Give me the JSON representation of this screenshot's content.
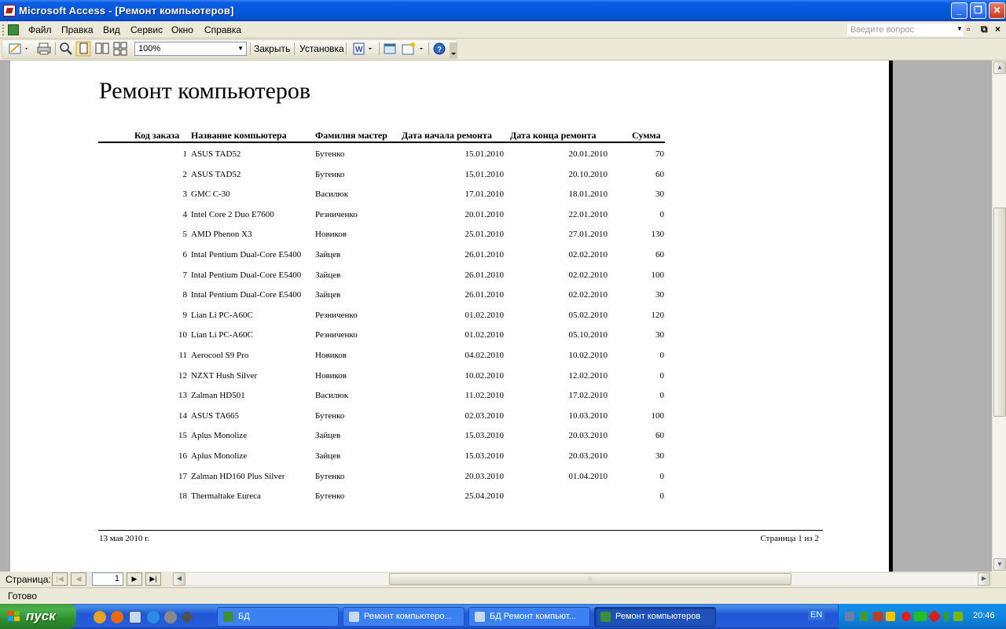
{
  "window": {
    "title": "Microsoft Access - [Ремонт компьютеров]"
  },
  "menu": {
    "items": [
      "Файл",
      "Правка",
      "Вид",
      "Сервис",
      "Окно",
      "Справка"
    ],
    "ask_placeholder": "Введите вопрос"
  },
  "toolbar": {
    "zoom": "100%",
    "close_label": "Закрыть",
    "setup_label": "Установка"
  },
  "report": {
    "title": "Ремонт компьютеров",
    "columns": [
      "Код заказа",
      "Название компьютера",
      "Фамилия мастер",
      "Дата начала ремонта",
      "Дата конца ремонта",
      "Сумма"
    ],
    "rows": [
      [
        "1",
        "ASUS  TAD52",
        "Бутенко",
        "15.01.2010",
        "20.01.2010",
        "70"
      ],
      [
        "2",
        "ASUS  TAD52",
        "Бутенко",
        "15.01.2010",
        "20.10.2010",
        "60"
      ],
      [
        "3",
        "GMC C-30",
        "Василюк",
        "17.01.2010",
        "18.01.2010",
        "30"
      ],
      [
        "4",
        "Intel Core 2 Duo E7600",
        "Резниченко",
        "20.01.2010",
        "22.01.2010",
        "0"
      ],
      [
        "5",
        "AMD Phenon X3",
        "Новиков",
        "25.01.2010",
        "27.01.2010",
        "130"
      ],
      [
        "6",
        "Intal Pentium Dual-Core E5400",
        "Зайцев",
        "26.01.2010",
        "02.02.2010",
        "60"
      ],
      [
        "7",
        "Intal Pentium Dual-Core E5400",
        "Зайцев",
        "26.01.2010",
        "02.02.2010",
        "100"
      ],
      [
        "8",
        "Intal Pentium Dual-Core E5400",
        "Зайцев",
        "26.01.2010",
        "02.02.2010",
        "30"
      ],
      [
        "9",
        "Lian Li PC-A60C",
        "Резниченко",
        "01.02.2010",
        "05.02.2010",
        "120"
      ],
      [
        "10",
        "Lian Li PC-A60C",
        "Резниченко",
        "01.02.2010",
        "05.10.2010",
        "30"
      ],
      [
        "11",
        "Aerocool S9 Pro",
        "Новиков",
        "04.02.2010",
        "10.02.2010",
        "0"
      ],
      [
        "12",
        "NZXT Hush Silver",
        "Новиков",
        "10.02.2010",
        "12.02.2010",
        "0"
      ],
      [
        "13",
        "Zalman HD501",
        "Василюк",
        "11.02.2010",
        "17.02.2010",
        "0"
      ],
      [
        "14",
        "ASUS  TA665",
        "Бутенко",
        "02.03.2010",
        "10.03.2010",
        "100"
      ],
      [
        "15",
        "Aplus Monolize",
        "Зайцев",
        "15.03.2010",
        "20.03.2010",
        "60"
      ],
      [
        "16",
        "Aplus Monolize",
        "Зайцев",
        "15.03.2010",
        "20.03.2010",
        "30"
      ],
      [
        "17",
        "Zalman HD160 Plus Silver",
        "Бутенко",
        "20.03.2010",
        "01.04.2010",
        "0"
      ],
      [
        "18",
        "Thermaltake Eureca",
        "Бутенко",
        "25.04.2010",
        "",
        "0"
      ]
    ],
    "footer_date": "13 мая 2010 г.",
    "footer_page": "Страница 1 из 2"
  },
  "navigation": {
    "label": "Страница:",
    "current_page": "1"
  },
  "status": {
    "text": "Готово"
  },
  "taskbar": {
    "start_label": "пуск",
    "tasks": [
      "БД",
      "Ремонт компьютеро...",
      "БД Ремонт компьют...",
      "Ремонт компьютеров"
    ],
    "active_task": "Ремонт компьютеров",
    "language": "EN",
    "clock": "20:46"
  },
  "colors": {
    "titlebar": "#0558DC",
    "taskbar": "#245EDC",
    "start_button": "#3C9A3C",
    "workspace": "#B0B0B0"
  }
}
